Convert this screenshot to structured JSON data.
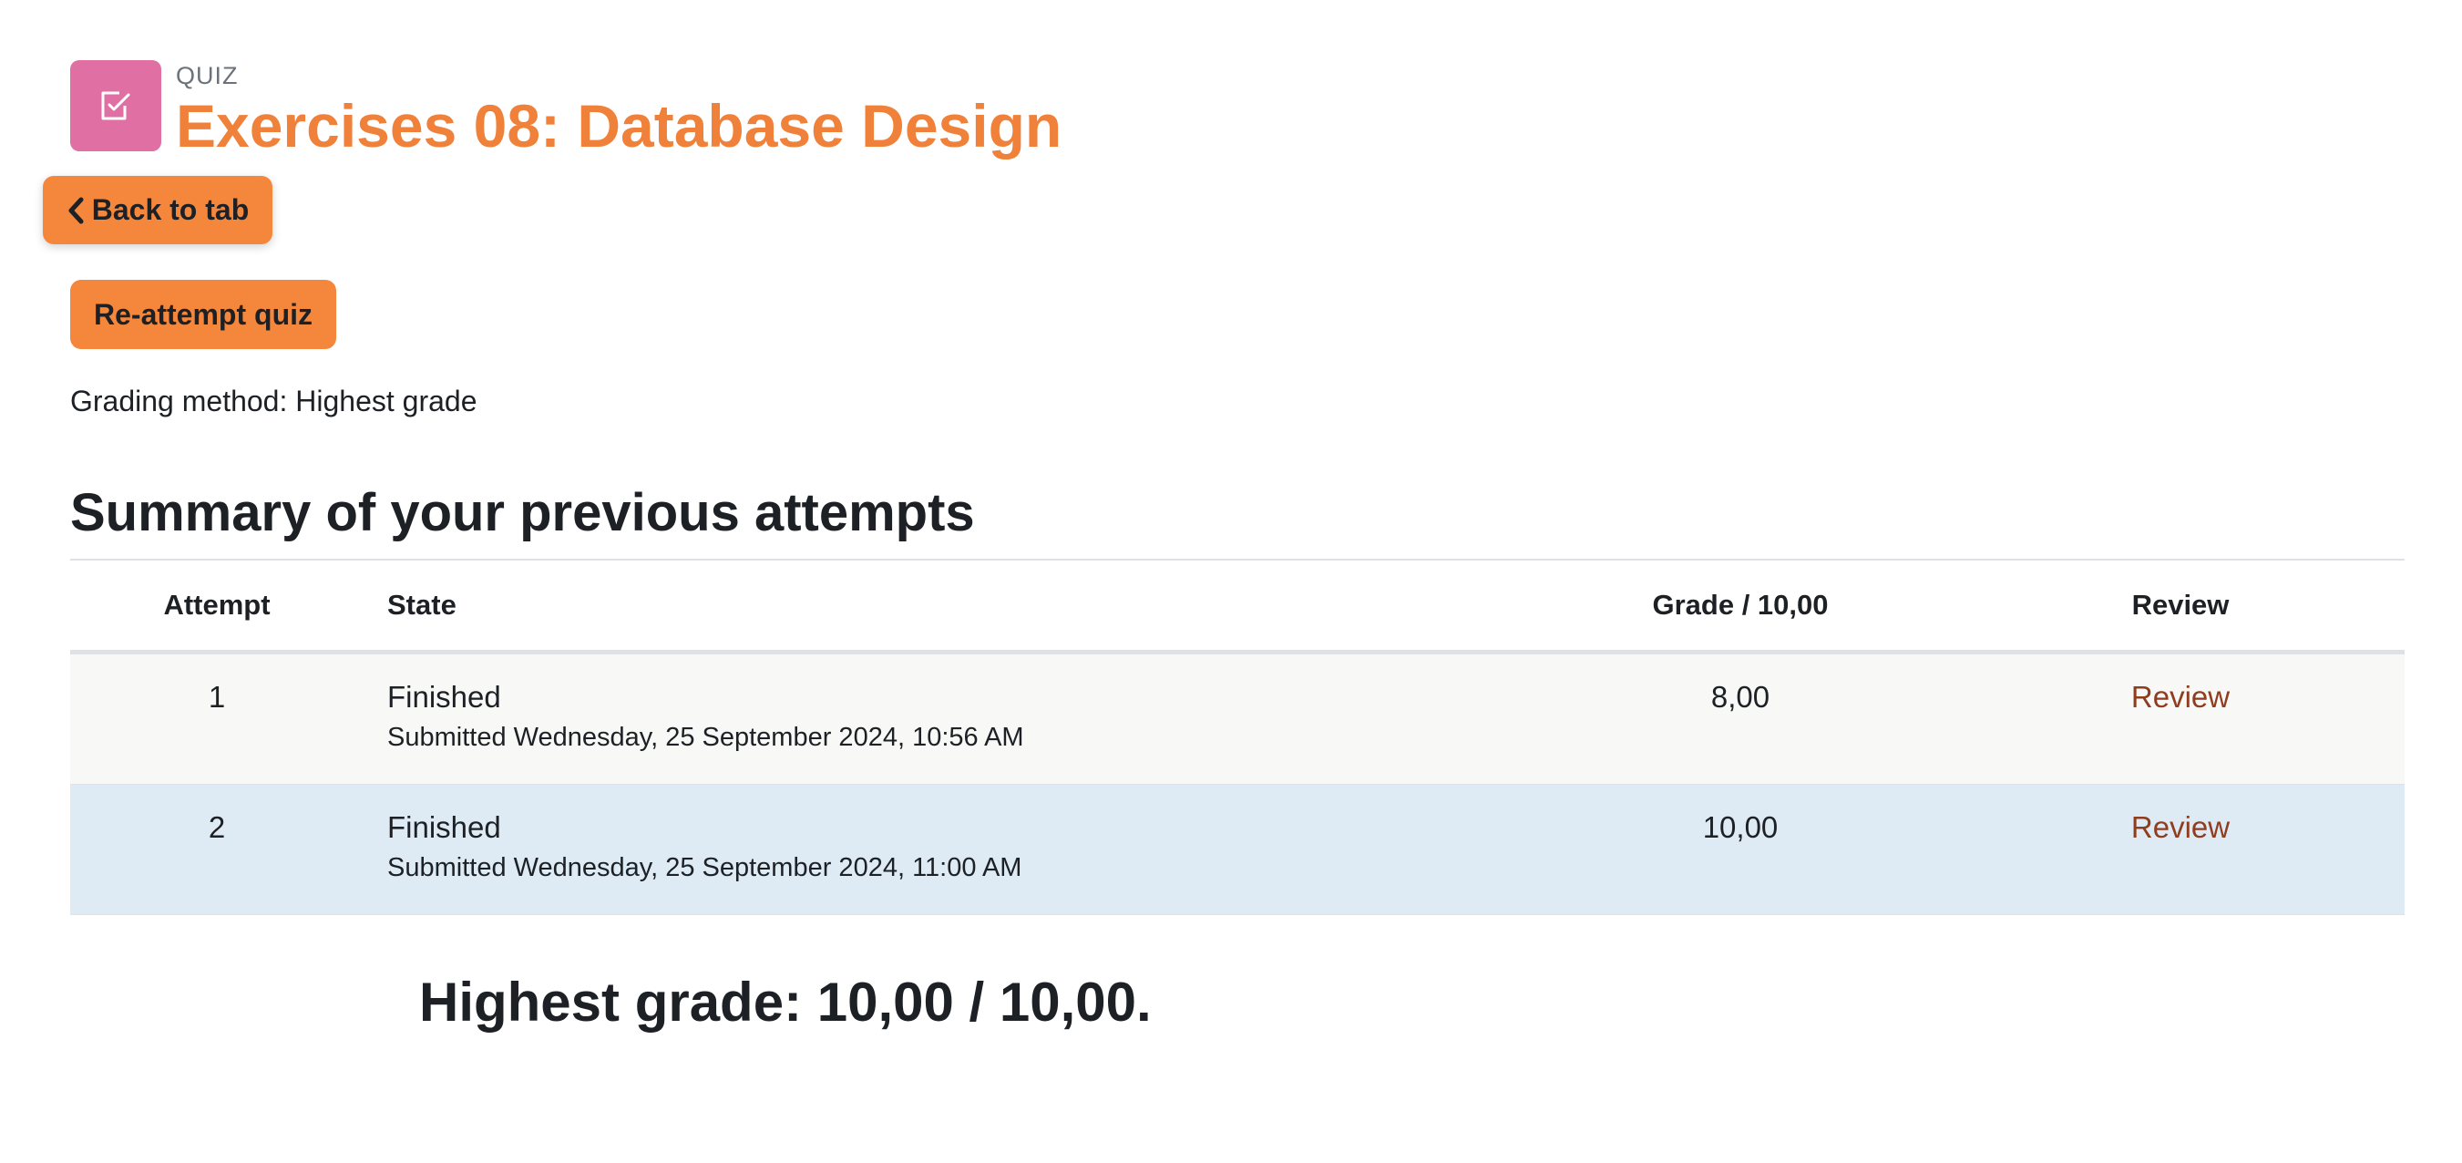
{
  "header": {
    "activity_type": "QUIZ",
    "title": "Exercises 08: Database Design",
    "icon": "quiz-checkbox-icon"
  },
  "buttons": {
    "back_label": "Back to tab",
    "reattempt_label": "Re-attempt quiz"
  },
  "grading_method": "Grading method: Highest grade",
  "summary": {
    "heading": "Summary of your previous attempts",
    "columns": {
      "attempt": "Attempt",
      "state": "State",
      "grade": "Grade / 10,00",
      "review": "Review"
    },
    "rows": [
      {
        "attempt": "1",
        "state": "Finished",
        "submitted": "Submitted Wednesday, 25 September 2024, 10:56 AM",
        "grade": "8,00",
        "review": "Review"
      },
      {
        "attempt": "2",
        "state": "Finished",
        "submitted": "Submitted Wednesday, 25 September 2024, 11:00 AM",
        "grade": "10,00",
        "review": "Review"
      }
    ]
  },
  "highest_grade": "Highest grade: 10,00 / 10,00.",
  "colors": {
    "accent": "#f5873c",
    "title": "#f0813a",
    "quiz_icon_bg": "#e06fa4",
    "link": "#8e3d1e",
    "highlight_row": "#deebf5"
  }
}
